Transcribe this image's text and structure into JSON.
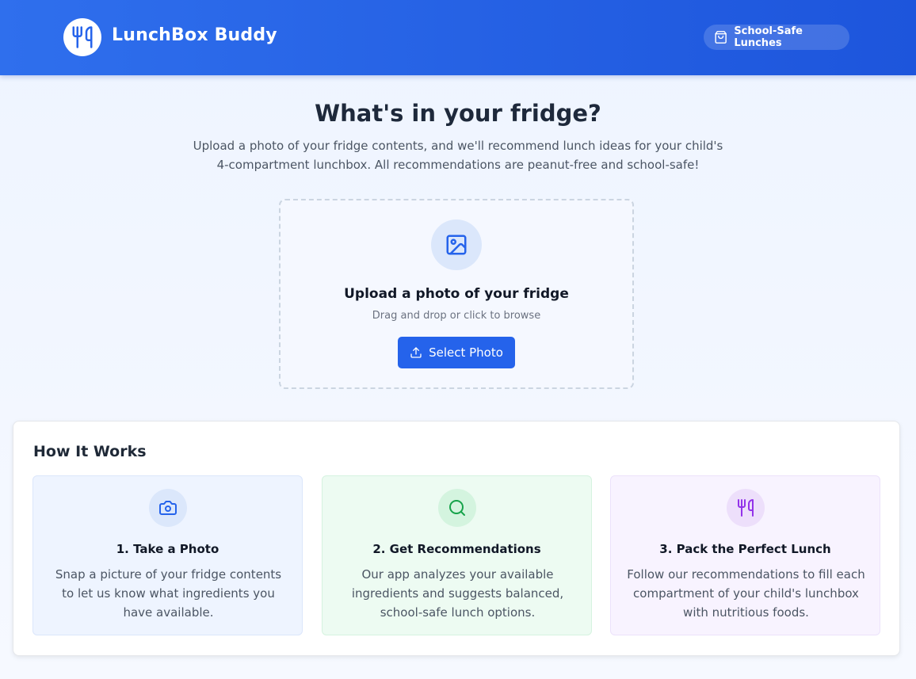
{
  "header": {
    "brand": "LunchBox Buddy",
    "logo_icon": "fork-knife-icon",
    "badge_icon": "shopping-bag-icon",
    "badge_label": "School-Safe Lunches"
  },
  "hero": {
    "title": "What's in your fridge?",
    "subtitle": "Upload a photo of your fridge contents, and we'll recommend lunch ideas for your child's 4-compartment lunchbox. All recommendations are peanut-free and school-safe!"
  },
  "upload": {
    "icon": "image-icon",
    "title": "Upload a photo of your fridge",
    "hint": "Drag and drop or click to browse",
    "button_icon": "upload-icon",
    "button_label": "Select Photo"
  },
  "how_it_works": {
    "title": "How It Works",
    "steps": [
      {
        "icon": "camera-icon",
        "title": "1. Take a Photo",
        "description": "Snap a picture of your fridge contents to let us know what ingredients you have available."
      },
      {
        "icon": "search-icon",
        "title": "2. Get Recommendations",
        "description": "Our app analyzes your available ingredients and suggests balanced, school-safe lunch options."
      },
      {
        "icon": "fork-knife-icon",
        "title": "3. Pack the Perfect Lunch",
        "description": "Follow our recommendations to fill each compartment of your child's lunchbox with nutritious foods."
      }
    ]
  },
  "colors": {
    "primary": "#2563eb",
    "header_start": "#2f6fed",
    "header_end": "#1d55dc",
    "step1_accent": "#2563eb",
    "step2_accent": "#16a34a",
    "step3_accent": "#9333ea"
  }
}
